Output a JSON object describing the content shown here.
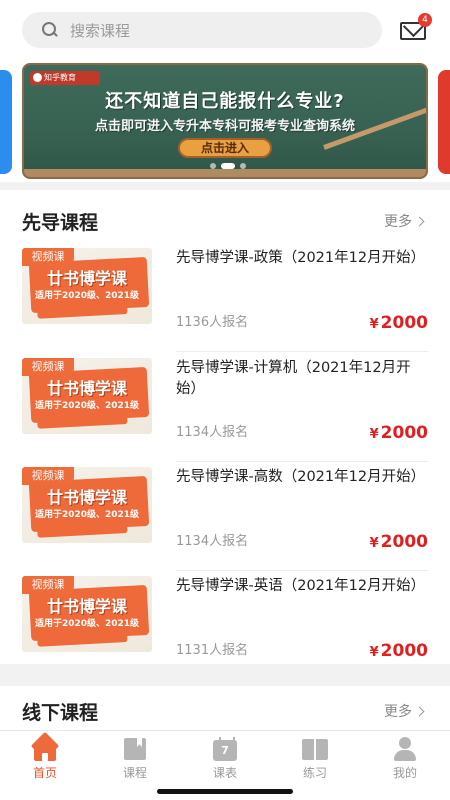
{
  "search": {
    "placeholder": "搜索课程"
  },
  "notifications": {
    "count": "4"
  },
  "banner": {
    "logo_text": "知乎教育",
    "headline": "还不知道自己能报什么专业?",
    "subline": "点击即可进入专升本专科可报考专业查询系统",
    "cta": "点击进入"
  },
  "sections": {
    "pilot": {
      "title": "先导课程",
      "more": "更多"
    },
    "offline": {
      "title": "线下课程",
      "more": "更多"
    }
  },
  "courses": [
    {
      "tag": "视频课",
      "thumb_title": "廿书博学课",
      "thumb_sub": "适用于2020级、2021级",
      "title": "先导博学课-政策（2021年12月开始）",
      "count": "1136人报名",
      "currency": "¥",
      "price": "2000"
    },
    {
      "tag": "视频课",
      "thumb_title": "廿书博学课",
      "thumb_sub": "适用于2020级、2021级",
      "title": "先导博学课-计算机（2021年12月开始）",
      "count": "1134人报名",
      "currency": "¥",
      "price": "2000"
    },
    {
      "tag": "视频课",
      "thumb_title": "廿书博学课",
      "thumb_sub": "适用于2020级、2021级",
      "title": "先导博学课-高数（2021年12月开始）",
      "count": "1134人报名",
      "currency": "¥",
      "price": "2000"
    },
    {
      "tag": "视频课",
      "thumb_title": "廿书博学课",
      "thumb_sub": "适用于2020级、2021级",
      "title": "先导博学课-英语（2021年12月开始）",
      "count": "1131人报名",
      "currency": "¥",
      "price": "2000"
    }
  ],
  "tabs": [
    {
      "label": "首页",
      "icon": "home-icon",
      "active": true
    },
    {
      "label": "课程",
      "icon": "book-icon",
      "active": false
    },
    {
      "label": "课表",
      "icon": "calendar-icon",
      "calendar_day": "7",
      "active": false
    },
    {
      "label": "练习",
      "icon": "open-book-icon",
      "active": false
    },
    {
      "label": "我的",
      "icon": "user-icon",
      "active": false
    }
  ],
  "colors": {
    "accent": "#e8572e",
    "price": "#e02020",
    "badge": "#e63a2e"
  }
}
